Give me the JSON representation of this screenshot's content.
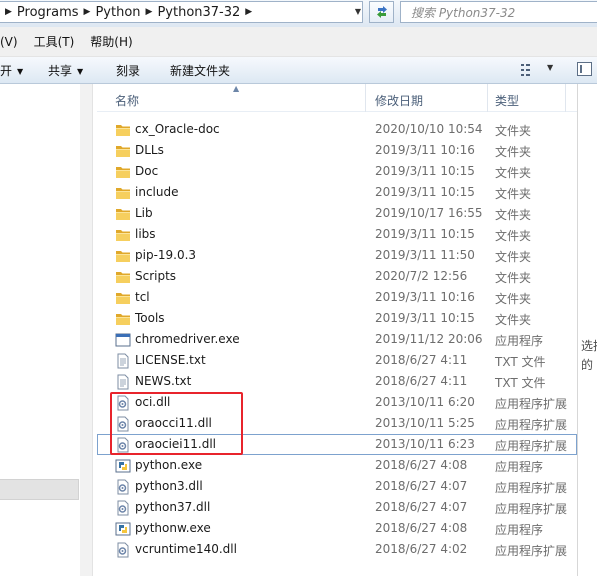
{
  "address": {
    "crumbs": [
      "Programs",
      "Python",
      "Python37-32"
    ],
    "search_placeholder": "搜索 Python37-32"
  },
  "menu": {
    "items": [
      "(V)",
      "工具(T)",
      "帮助(H)"
    ]
  },
  "toolbar": {
    "open_label": "开",
    "share_label": "共享",
    "burn_label": "刻录",
    "new_folder_label": "新建文件夹"
  },
  "columns": {
    "name": "名称",
    "date": "修改日期",
    "type": "类型"
  },
  "files": [
    {
      "name": "cx_Oracle-doc",
      "date": "2020/10/10 10:54",
      "type": "文件夹",
      "icon": "folder-icon"
    },
    {
      "name": "DLLs",
      "date": "2019/3/11 10:16",
      "type": "文件夹",
      "icon": "folder-icon"
    },
    {
      "name": "Doc",
      "date": "2019/3/11 10:15",
      "type": "文件夹",
      "icon": "folder-icon"
    },
    {
      "name": "include",
      "date": "2019/3/11 10:15",
      "type": "文件夹",
      "icon": "folder-icon"
    },
    {
      "name": "Lib",
      "date": "2019/10/17 16:55",
      "type": "文件夹",
      "icon": "folder-icon"
    },
    {
      "name": "libs",
      "date": "2019/3/11 10:15",
      "type": "文件夹",
      "icon": "folder-icon"
    },
    {
      "name": "pip-19.0.3",
      "date": "2019/3/11 11:50",
      "type": "文件夹",
      "icon": "folder-icon"
    },
    {
      "name": "Scripts",
      "date": "2020/7/2 12:56",
      "type": "文件夹",
      "icon": "folder-icon"
    },
    {
      "name": "tcl",
      "date": "2019/3/11 10:16",
      "type": "文件夹",
      "icon": "folder-icon"
    },
    {
      "name": "Tools",
      "date": "2019/3/11 10:15",
      "type": "文件夹",
      "icon": "folder-icon"
    },
    {
      "name": "chromedriver.exe",
      "date": "2019/11/12 20:06",
      "type": "应用程序",
      "icon": "exe-icon"
    },
    {
      "name": "LICENSE.txt",
      "date": "2018/6/27 4:11",
      "type": "TXT 文件",
      "icon": "text-file-icon"
    },
    {
      "name": "NEWS.txt",
      "date": "2018/6/27 4:11",
      "type": "TXT 文件",
      "icon": "text-file-icon"
    },
    {
      "name": "oci.dll",
      "date": "2013/10/11 6:20",
      "type": "应用程序扩展",
      "icon": "dll-icon"
    },
    {
      "name": "oraocci11.dll",
      "date": "2013/10/11 5:25",
      "type": "应用程序扩展",
      "icon": "dll-icon"
    },
    {
      "name": "oraociei11.dll",
      "date": "2013/10/11 6:23",
      "type": "应用程序扩展",
      "icon": "dll-icon"
    },
    {
      "name": "python.exe",
      "date": "2018/6/27 4:08",
      "type": "应用程序",
      "icon": "python-icon"
    },
    {
      "name": "python3.dll",
      "date": "2018/6/27 4:07",
      "type": "应用程序扩展",
      "icon": "dll-icon"
    },
    {
      "name": "python37.dll",
      "date": "2018/6/27 4:07",
      "type": "应用程序扩展",
      "icon": "dll-icon"
    },
    {
      "name": "pythonw.exe",
      "date": "2018/6/27 4:08",
      "type": "应用程序",
      "icon": "python-icon"
    },
    {
      "name": "vcruntime140.dll",
      "date": "2018/6/27 4:02",
      "type": "应用程序扩展",
      "icon": "dll-icon"
    }
  ],
  "details_pane": {
    "lines": [
      "选择",
      "的"
    ]
  },
  "colors": {
    "highlight_box": "#e8242c",
    "folder": "#f0c14b",
    "toolbar_gradient_top": "#f6f9fd",
    "toolbar_gradient_bottom": "#dde8f3"
  }
}
